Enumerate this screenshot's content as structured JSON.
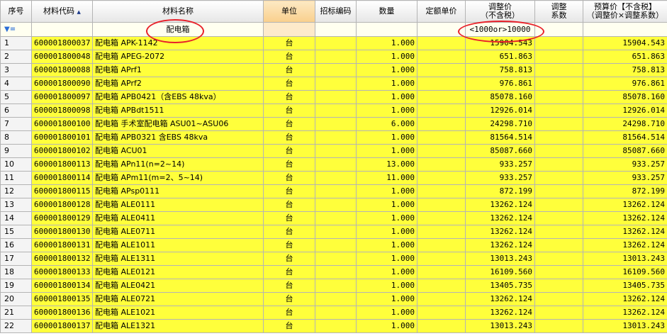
{
  "columns": [
    "序号",
    "材料代码",
    "材料名称",
    "单位",
    "招标编码",
    "数量",
    "定额单价",
    "调整价\n（不含税）",
    "调整\n系数",
    "预算价【不含税】\n（调整价×调整系数）"
  ],
  "filter": {
    "icon": "filter-icon",
    "name": "配电箱",
    "price": "<1000or>10000"
  },
  "sort_icon": "sort-asc-icon",
  "rows": [
    [
      "1",
      "600001800037",
      "配电箱 APK-1142",
      "台",
      "",
      "1.000",
      "",
      "15904.543",
      "",
      "15904.543"
    ],
    [
      "2",
      "600001800048",
      "配电箱 APEG-2072",
      "台",
      "",
      "1.000",
      "",
      "651.863",
      "",
      "651.863"
    ],
    [
      "3",
      "600001800088",
      "配电箱 APrf1",
      "台",
      "",
      "1.000",
      "",
      "758.813",
      "",
      "758.813"
    ],
    [
      "4",
      "600001800090",
      "配电箱 APrf2",
      "台",
      "",
      "1.000",
      "",
      "976.861",
      "",
      "976.861"
    ],
    [
      "5",
      "600001800097",
      "配电箱 APB0421（含EBS 48kva）",
      "台",
      "",
      "1.000",
      "",
      "85078.160",
      "",
      "85078.160"
    ],
    [
      "6",
      "600001800098",
      "配电箱 APBdt1511",
      "台",
      "",
      "1.000",
      "",
      "12926.014",
      "",
      "12926.014"
    ],
    [
      "7",
      "600001800100",
      "配电箱 手术室配电箱 ASU01~ASU06",
      "台",
      "",
      "6.000",
      "",
      "24298.710",
      "",
      "24298.710"
    ],
    [
      "8",
      "600001800101",
      "配电箱 APB0321 含EBS 48kva",
      "台",
      "",
      "1.000",
      "",
      "81564.514",
      "",
      "81564.514"
    ],
    [
      "9",
      "600001800102",
      "配电箱 ACU01",
      "台",
      "",
      "1.000",
      "",
      "85087.660",
      "",
      "85087.660"
    ],
    [
      "10",
      "600001800113",
      "配电箱 APn11(n=2~14)",
      "台",
      "",
      "13.000",
      "",
      "933.257",
      "",
      "933.257"
    ],
    [
      "11",
      "600001800114",
      "配电箱 APm11(m=2、5~14)",
      "台",
      "",
      "11.000",
      "",
      "933.257",
      "",
      "933.257"
    ],
    [
      "12",
      "600001800115",
      "配电箱 APsp0111",
      "台",
      "",
      "1.000",
      "",
      "872.199",
      "",
      "872.199"
    ],
    [
      "13",
      "600001800128",
      "配电箱 ALE0111",
      "台",
      "",
      "1.000",
      "",
      "13262.124",
      "",
      "13262.124"
    ],
    [
      "14",
      "600001800129",
      "配电箱 ALE0411",
      "台",
      "",
      "1.000",
      "",
      "13262.124",
      "",
      "13262.124"
    ],
    [
      "15",
      "600001800130",
      "配电箱 ALE0711",
      "台",
      "",
      "1.000",
      "",
      "13262.124",
      "",
      "13262.124"
    ],
    [
      "16",
      "600001800131",
      "配电箱 ALE1011",
      "台",
      "",
      "1.000",
      "",
      "13262.124",
      "",
      "13262.124"
    ],
    [
      "17",
      "600001800132",
      "配电箱 ALE1311",
      "台",
      "",
      "1.000",
      "",
      "13013.243",
      "",
      "13013.243"
    ],
    [
      "18",
      "600001800133",
      "配电箱 ALE0121",
      "台",
      "",
      "1.000",
      "",
      "16109.560",
      "",
      "16109.560"
    ],
    [
      "19",
      "600001800134",
      "配电箱 ALE0421",
      "台",
      "",
      "1.000",
      "",
      "13405.735",
      "",
      "13405.735"
    ],
    [
      "20",
      "600001800135",
      "配电箱 ALE0721",
      "台",
      "",
      "1.000",
      "",
      "13262.124",
      "",
      "13262.124"
    ],
    [
      "21",
      "600001800136",
      "配电箱 ALE1021",
      "台",
      "",
      "1.000",
      "",
      "13262.124",
      "",
      "13262.124"
    ],
    [
      "22",
      "600001800137",
      "配电箱 ALE1321",
      "台",
      "",
      "1.000",
      "",
      "13013.243",
      "",
      "13013.243"
    ]
  ]
}
